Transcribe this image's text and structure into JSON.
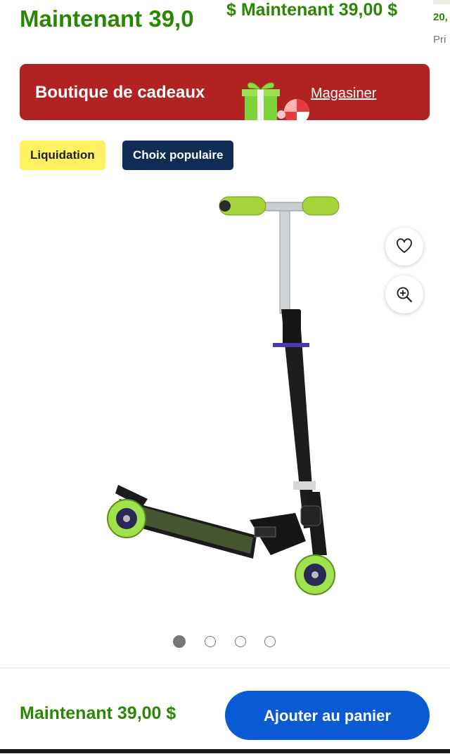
{
  "header": {
    "price_now": "Maintenant 39,0",
    "price_now_overlap": "$ Maintenant 39,00 $",
    "edge_text_1": "20,",
    "edge_text_2": "Pri"
  },
  "promo_banner": {
    "title": "Boutique de cadeaux",
    "link": "Magasiner",
    "color": "#b12222"
  },
  "badges": [
    {
      "label": "Liquidation",
      "color": "#fff15f"
    },
    {
      "label": "Choix populaire",
      "color": "#0f2c55"
    }
  ],
  "product_image": {
    "alt": "trottinette",
    "icons": [
      "heart-icon",
      "zoom-in-icon"
    ]
  },
  "carousel": {
    "total": 4,
    "active_index": 0
  },
  "footer": {
    "price": "Maintenant 39,00 $",
    "add_to_cart": "Ajouter au panier",
    "accent": "#0a5bd3",
    "price_color": "#2a8703"
  }
}
